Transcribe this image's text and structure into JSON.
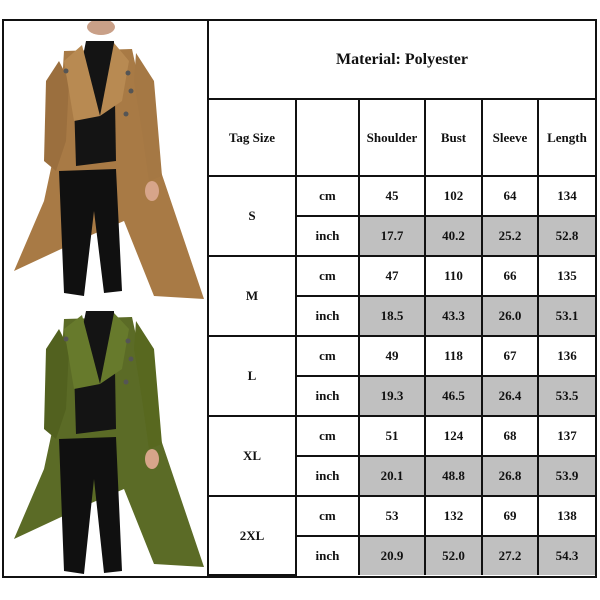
{
  "product_images": [
    {
      "name": "trench-coat-tan",
      "coat_color": "#a87a45"
    },
    {
      "name": "trench-coat-green",
      "coat_color": "#5b6b26"
    }
  ],
  "table": {
    "title": "Material: Polyester",
    "headers": {
      "tag_size": "Tag Size",
      "unit": "",
      "shoulder": "Shoulder",
      "bust": "Bust",
      "sleeve": "Sleeve",
      "length": "Length"
    },
    "highlight_color": "#c0c0c0",
    "sizes": [
      {
        "tag": "S",
        "cm": {
          "unit": "cm",
          "shoulder": "45",
          "bust": "102",
          "sleeve": "64",
          "length": "134"
        },
        "inch": {
          "unit": "inch",
          "shoulder": "17.7",
          "bust": "40.2",
          "sleeve": "25.2",
          "length": "52.8"
        }
      },
      {
        "tag": "M",
        "cm": {
          "unit": "cm",
          "shoulder": "47",
          "bust": "110",
          "sleeve": "66",
          "length": "135"
        },
        "inch": {
          "unit": "inch",
          "shoulder": "18.5",
          "bust": "43.3",
          "sleeve": "26.0",
          "length": "53.1"
        }
      },
      {
        "tag": "L",
        "cm": {
          "unit": "cm",
          "shoulder": "49",
          "bust": "118",
          "sleeve": "67",
          "length": "136"
        },
        "inch": {
          "unit": "inch",
          "shoulder": "19.3",
          "bust": "46.5",
          "sleeve": "26.4",
          "length": "53.5"
        }
      },
      {
        "tag": "XL",
        "cm": {
          "unit": "cm",
          "shoulder": "51",
          "bust": "124",
          "sleeve": "68",
          "length": "137"
        },
        "inch": {
          "unit": "inch",
          "shoulder": "20.1",
          "bust": "48.8",
          "sleeve": "26.8",
          "length": "53.9"
        }
      },
      {
        "tag": "2XL",
        "cm": {
          "unit": "cm",
          "shoulder": "53",
          "bust": "132",
          "sleeve": "69",
          "length": "138"
        },
        "inch": {
          "unit": "inch",
          "shoulder": "20.9",
          "bust": "52.0",
          "sleeve": "27.2",
          "length": "54.3"
        }
      }
    ]
  }
}
